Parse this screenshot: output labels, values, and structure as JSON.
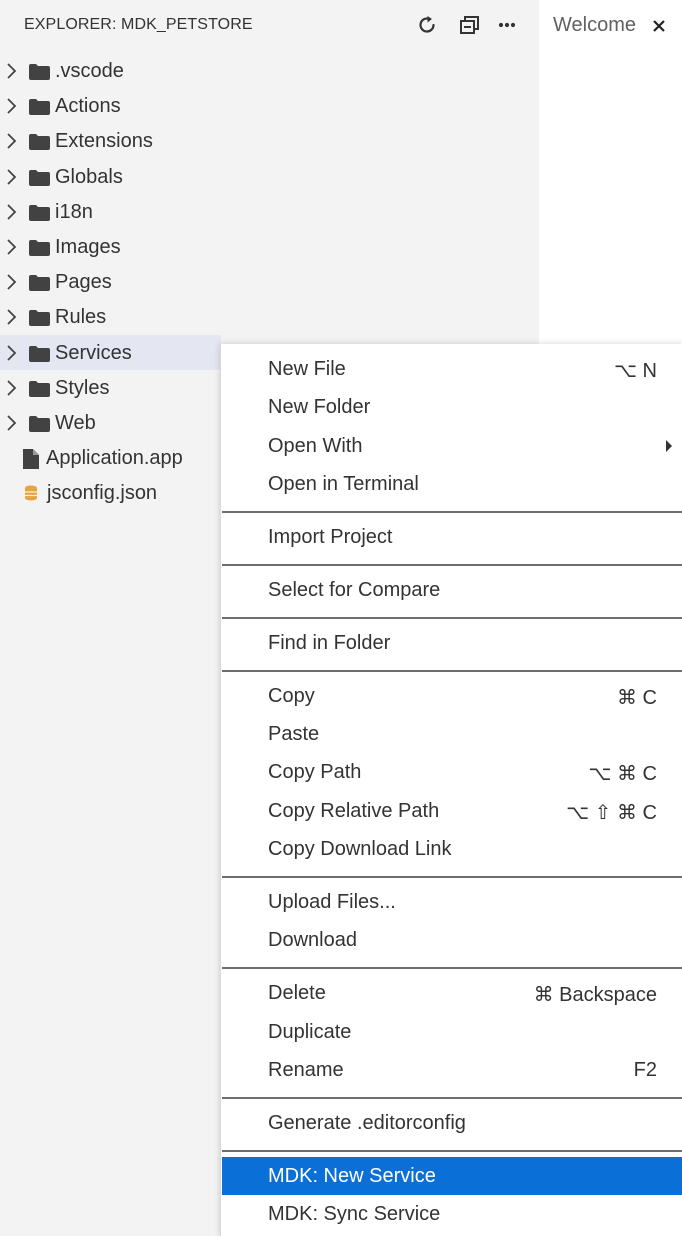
{
  "explorer": {
    "title": "EXPLORER: MDK_PETSTORE",
    "actions": {
      "refresh_icon": "refresh-icon",
      "collapse_icon": "collapse-all-icon",
      "more_icon": "more-icon",
      "more_label": "···"
    },
    "items": [
      {
        "label": ".vscode",
        "type": "folder"
      },
      {
        "label": "Actions",
        "type": "folder"
      },
      {
        "label": "Extensions",
        "type": "folder"
      },
      {
        "label": "Globals",
        "type": "folder"
      },
      {
        "label": "i18n",
        "type": "folder"
      },
      {
        "label": "Images",
        "type": "folder"
      },
      {
        "label": "Pages",
        "type": "folder"
      },
      {
        "label": "Rules",
        "type": "folder"
      },
      {
        "label": "Services",
        "type": "folder",
        "selected": true
      },
      {
        "label": "Styles",
        "type": "folder"
      },
      {
        "label": "Web",
        "type": "folder"
      },
      {
        "label": "Application.app",
        "type": "file"
      },
      {
        "label": "jsconfig.json",
        "type": "json"
      }
    ]
  },
  "editor": {
    "tab": {
      "label": "Welcome",
      "close": "×"
    }
  },
  "context_menu": {
    "items": [
      {
        "label": "New File",
        "shortcut": "⌥ N"
      },
      {
        "label": "New Folder",
        "shortcut": ""
      },
      {
        "label": "Open With",
        "shortcut": "",
        "submenu": true
      },
      {
        "label": "Open in Terminal",
        "shortcut": ""
      },
      {
        "label": "Import Project",
        "shortcut": ""
      },
      {
        "label": "Select for Compare",
        "shortcut": ""
      },
      {
        "label": "Find in Folder",
        "shortcut": ""
      },
      {
        "label": "Copy",
        "shortcut": "⌘ C"
      },
      {
        "label": "Paste",
        "shortcut": ""
      },
      {
        "label": "Copy Path",
        "shortcut": "⌥ ⌘ C"
      },
      {
        "label": "Copy Relative Path",
        "shortcut": "⌥ ⇧ ⌘ C"
      },
      {
        "label": "Copy Download Link",
        "shortcut": ""
      },
      {
        "label": "Upload Files...",
        "shortcut": ""
      },
      {
        "label": "Download",
        "shortcut": ""
      },
      {
        "label": "Delete",
        "shortcut": "⌘ Backspace"
      },
      {
        "label": "Duplicate",
        "shortcut": ""
      },
      {
        "label": "Rename",
        "shortcut": "F2"
      },
      {
        "label": "Generate .editorconfig",
        "shortcut": ""
      },
      {
        "label": "MDK: New Service",
        "shortcut": "",
        "highlighted": true
      },
      {
        "label": "MDK: Sync Service",
        "shortcut": ""
      }
    ]
  },
  "colors": {
    "sidebar_bg": "#f3f3f3",
    "selected_row_bg": "#e4e6f1",
    "menu_highlight": "#0a6fd6",
    "json_icon": "#e8a33d"
  }
}
